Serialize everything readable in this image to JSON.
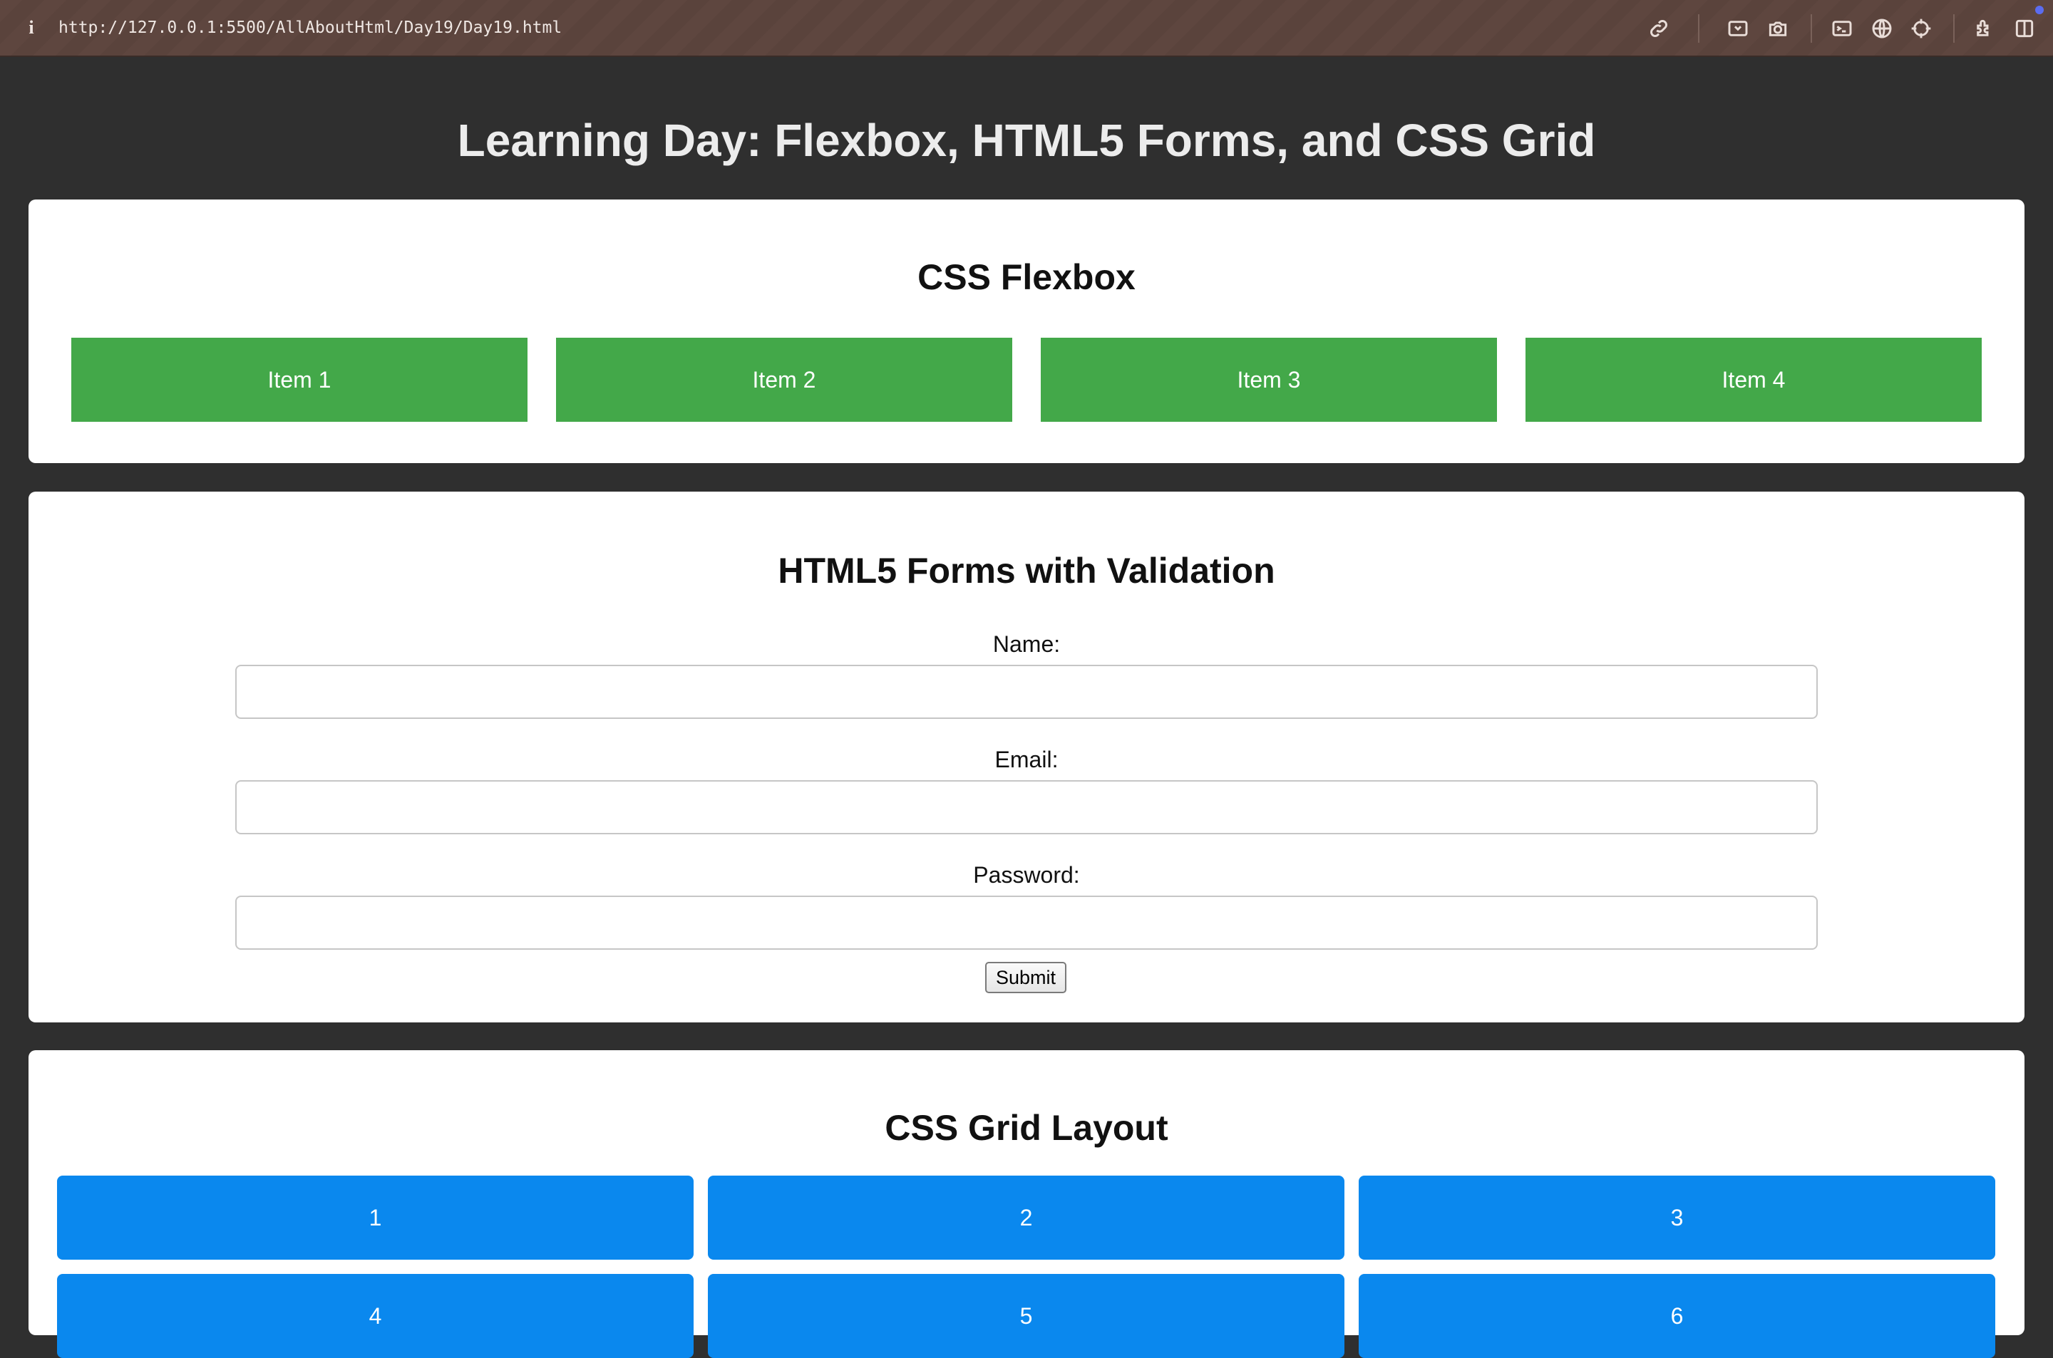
{
  "browser": {
    "url": "http://127.0.0.1:5500/AllAboutHtml/Day19/Day19.html",
    "info_icon": "i",
    "toolbar_icons": [
      "link-icon",
      "screenshot-icon",
      "camera-icon",
      "terminal-icon",
      "globe-icon",
      "crosshair-icon",
      "extensions-icon",
      "sidebar-icon"
    ]
  },
  "page": {
    "title": "Learning Day: Flexbox, HTML5 Forms, and CSS Grid"
  },
  "flexbox": {
    "title": "CSS Flexbox",
    "items": [
      "Item 1",
      "Item 2",
      "Item 3",
      "Item 4"
    ],
    "item_color": "#43a849"
  },
  "form": {
    "title": "HTML5 Forms with Validation",
    "name_label": "Name:",
    "name_value": "",
    "email_label": "Email:",
    "email_value": "",
    "password_label": "Password:",
    "password_value": "",
    "submit_label": "Submit"
  },
  "grid": {
    "title": "CSS Grid Layout",
    "items": [
      "1",
      "2",
      "3",
      "4",
      "5",
      "6"
    ],
    "item_color": "#0a88ee"
  },
  "colors": {
    "background": "#2f2f2f",
    "card": "#ffffff"
  }
}
